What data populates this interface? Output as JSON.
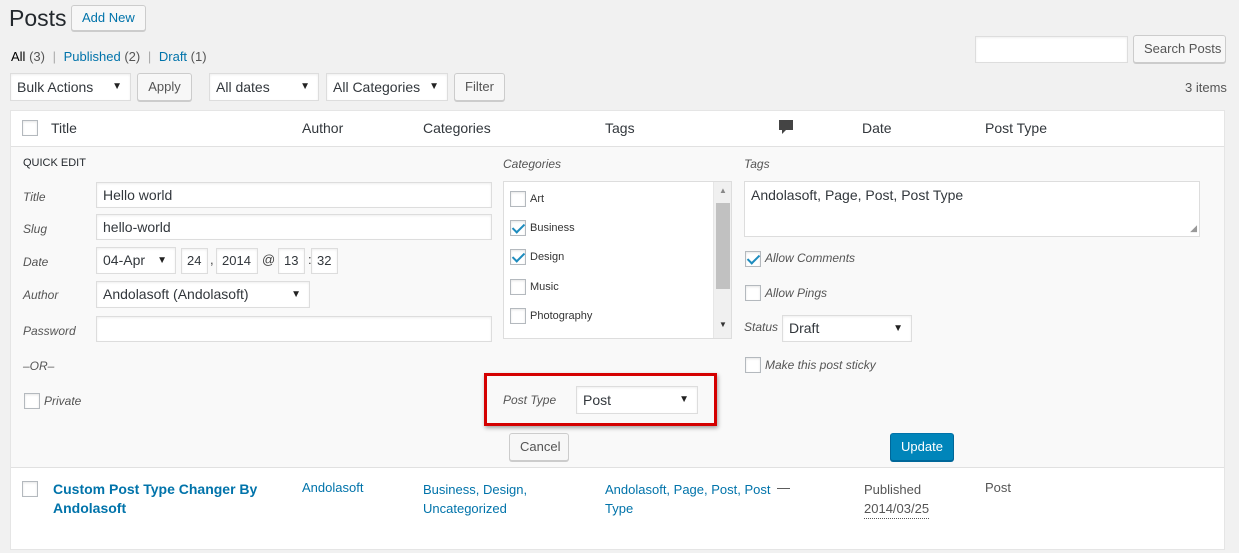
{
  "header": {
    "title": "Posts",
    "add_new": "Add New"
  },
  "filters": {
    "all": "All",
    "all_count": "(3)",
    "published": "Published",
    "published_count": "(2)",
    "draft": "Draft",
    "draft_count": "(1)",
    "sep": "|"
  },
  "search": {
    "value": "",
    "button": "Search Posts"
  },
  "toolbar": {
    "bulk_actions": "Bulk Actions",
    "apply": "Apply",
    "dates": "All dates",
    "categories": "All Categories",
    "filter": "Filter",
    "items_count": "3 items"
  },
  "columns": {
    "title": "Title",
    "author": "Author",
    "categories": "Categories",
    "tags": "Tags",
    "comments_icon": "comment-bubble-icon",
    "date": "Date",
    "post_type": "Post Type"
  },
  "quick_edit": {
    "heading": "QUICK EDIT",
    "title_label": "Title",
    "title_value": "Hello world",
    "slug_label": "Slug",
    "slug_value": "hello-world",
    "date_label": "Date",
    "month": "04-Apr",
    "day": "24",
    "comma": ",",
    "year": "2014",
    "at": "@",
    "hour": "13",
    "colon": ":",
    "minute": "32",
    "author_label": "Author",
    "author_value": "Andolasoft (Andolasoft)",
    "password_label": "Password",
    "password_value": "",
    "or_label": "–OR–",
    "private_label": "Private",
    "categories_label": "Categories",
    "categories": [
      {
        "name": "Art",
        "checked": false
      },
      {
        "name": "Business",
        "checked": true
      },
      {
        "name": "Design",
        "checked": true
      },
      {
        "name": "Music",
        "checked": false
      },
      {
        "name": "Photography",
        "checked": false
      }
    ],
    "post_type_label": "Post Type",
    "post_type_value": "Post",
    "tags_label": "Tags",
    "tags_value": "Andolasoft, Page, Post, Post Type",
    "allow_comments": "Allow Comments",
    "allow_pings": "Allow Pings",
    "status_label": "Status",
    "status_value": "Draft",
    "sticky_label": "Make this post sticky",
    "cancel": "Cancel",
    "update": "Update"
  },
  "row": {
    "title_line1": "Custom Post Type Changer By",
    "title_line2": "Andolasoft",
    "author": "Andolasoft",
    "categories_line1": "Business, Design,",
    "categories_line2": "Uncategorized",
    "tags_line1": "Andolasoft, Page, Post, Post",
    "tags_line2": "Type",
    "comments": "—",
    "date_status": "Published",
    "date_value": "2014/03/25",
    "post_type": "Post"
  },
  "colors": {
    "link": "#0073aa",
    "primary_button": "#0085ba",
    "highlight_box": "#d40000"
  }
}
